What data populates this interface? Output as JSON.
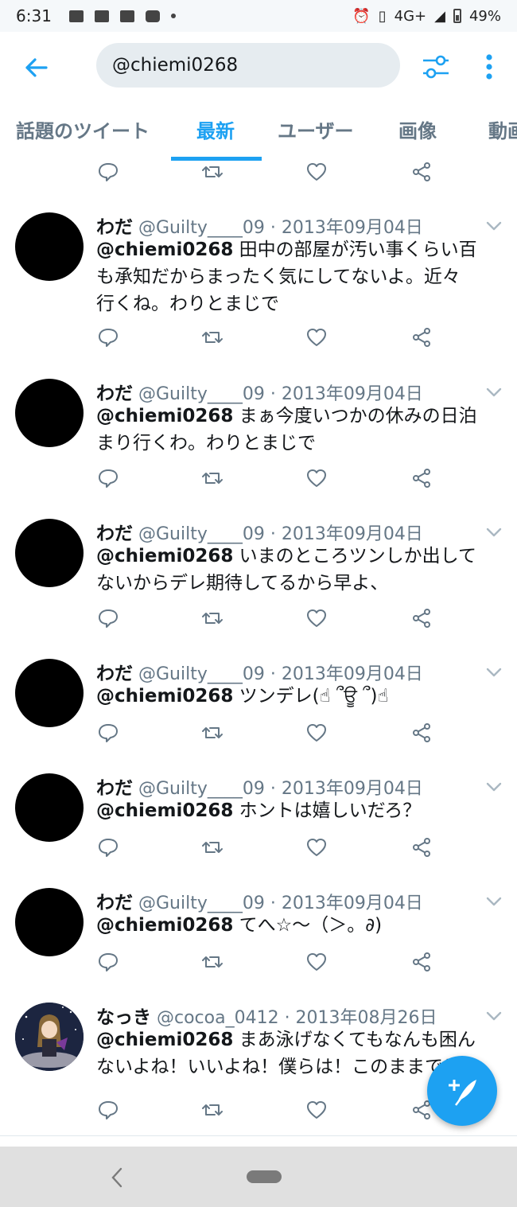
{
  "status_bar": {
    "time": "6:31",
    "network": "4G+",
    "battery": "49%"
  },
  "search": {
    "query": "@chiemi0268"
  },
  "tabs": [
    {
      "label": "話題のツイート"
    },
    {
      "label": "最新"
    },
    {
      "label": "ユーザー"
    },
    {
      "label": "画像"
    },
    {
      "label": "動画"
    }
  ],
  "tweets": [
    {
      "name": "わだ",
      "meta": "@Guilty____09 · 2013年09月04日",
      "mention": "@chiemi0268",
      "line1": "田中の部屋が汚い事くらい百",
      "line2": "も承知だからまったく気にしてないよ。近々",
      "line3": "行くね。わりとまじで"
    },
    {
      "name": "わだ",
      "meta": "@Guilty____09 · 2013年09月04日",
      "mention": "@chiemi0268",
      "line1": "まぁ今度いつかの休みの日泊",
      "line2": "まり行くわ。わりとまじで"
    },
    {
      "name": "わだ",
      "meta": "@Guilty____09 · 2013年09月04日",
      "mention": "@chiemi0268",
      "line1": "いまのところツンしか出して",
      "line2": "ないからデレ期待してるから早よ、"
    },
    {
      "name": "わだ",
      "meta": "@Guilty____09 · 2013年09月04日",
      "mention": "@chiemi0268",
      "line1": "ツンデレ(☝ ՞ਊ ՞)☝"
    },
    {
      "name": "わだ",
      "meta": "@Guilty____09 · 2013年09月04日",
      "mention": "@chiemi0268",
      "line1": "ホントは嬉しいだろ？"
    },
    {
      "name": "わだ",
      "meta": "@Guilty____09 · 2013年09月04日",
      "mention": "@chiemi0268",
      "line1": "てへ☆～（＞。∂)"
    },
    {
      "name": "なっき",
      "meta": "@cocoa_0412 · 2013年08月26日",
      "mention": "@chiemi0268",
      "line1": "まあ泳げなくてもなんも困ん",
      "line2": "ないよね！いいよね！僕らは！このままで！"
    }
  ]
}
